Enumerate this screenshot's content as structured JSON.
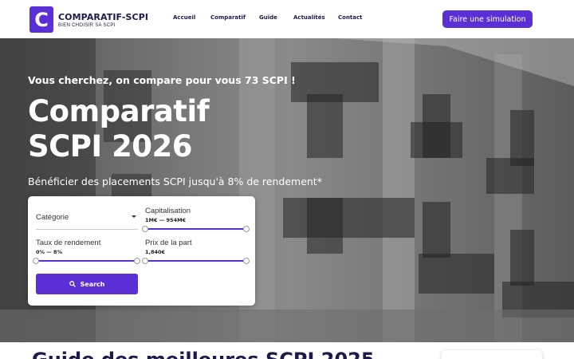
{
  "brand": {
    "logo_letter": "C",
    "name": "COMPARATIF-SCPI",
    "tagline": "BIEN CHOISIR SA SCPI",
    "color": "#5a2fd6"
  },
  "nav": {
    "items": [
      "Accueil",
      "Comparatif",
      "Guide",
      "Actualités",
      "Contact"
    ]
  },
  "header": {
    "cta_label": "Faire une simulation"
  },
  "hero": {
    "kicker": "Vous cherchez, on compare pour vous 73 SCPI !",
    "title_line1": "Comparatif",
    "title_line2": "SCPI 2026",
    "subtitle": "Bénéficier des placements SCPI jusqu'à 8% de rendement*"
  },
  "search": {
    "category_placeholder": "Catégorie",
    "capitalisation_label": "Capitalisation",
    "capitalisation_value": "1M€ — 954M€",
    "taux_label": "Taux de rendement",
    "taux_value": "0% — 8%",
    "prix_label": "Prix de la part",
    "prix_value": "1,840€",
    "button_label": "Search"
  },
  "bottom": {
    "guide_title": "Guide des meilleures SCPI 2025"
  }
}
